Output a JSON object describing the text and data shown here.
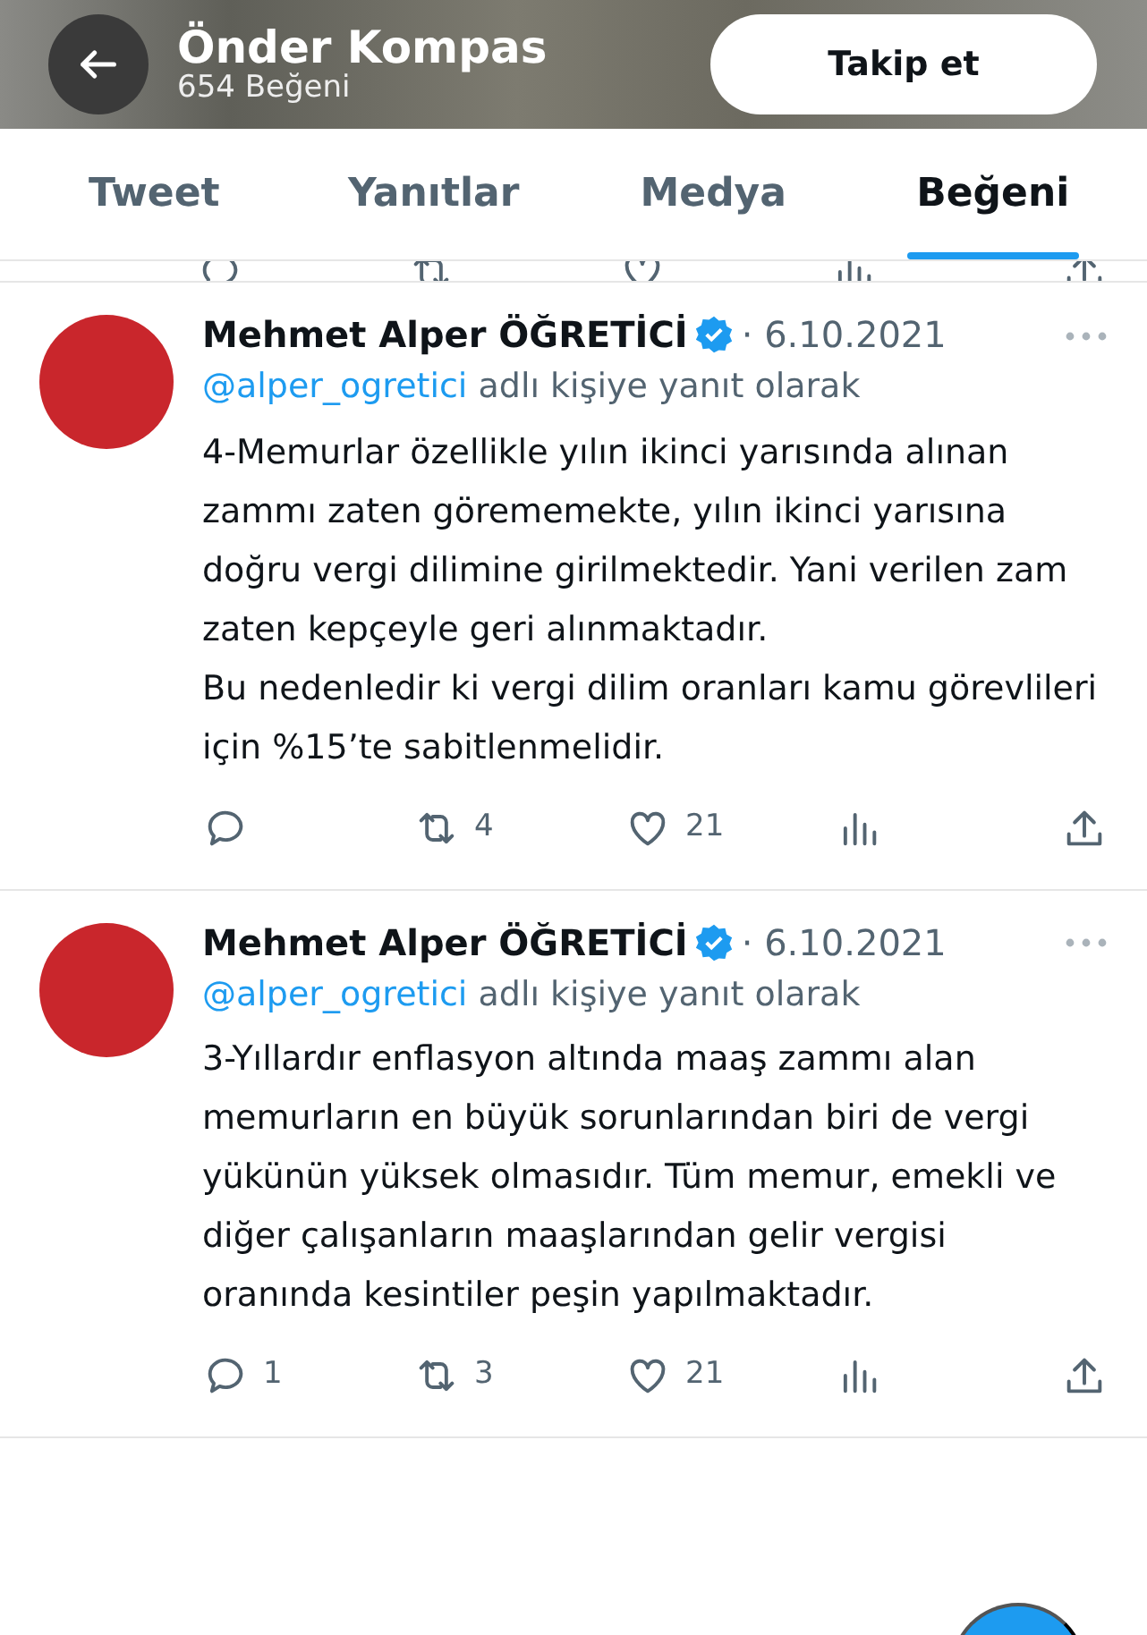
{
  "header": {
    "title": "Önder Kompas",
    "subtitle": "654 Beğeni",
    "follow_button": "Takip et"
  },
  "tabs": [
    {
      "label": "Tweet",
      "selected": false
    },
    {
      "label": "Yanıtlar",
      "selected": false
    },
    {
      "label": "Medya",
      "selected": false
    },
    {
      "label": "Beğeni",
      "selected": true
    }
  ],
  "tweets": [
    {
      "author": "Mehmet Alper ÖĞRETİCİ",
      "verified": true,
      "date": "· 6.10.2021",
      "reply_to_handle": "@alper_ogretici",
      "reply_to_text": "adlı kişiye yanıt olarak",
      "text": "4-Memurlar özellikle yılın ikinci yarısında alınan zammı zaten görememekte, yılın ikinci yarısına doğru vergi dilimine girilmektedir. Yani verilen zam zaten kepçeyle geri alınmaktadır.\nBu nedenledir ki vergi dilim oranları kamu görevlileri için %15’te sabitlenmelidir.",
      "retweets": "4",
      "likes": "21"
    },
    {
      "author": "Mehmet Alper ÖĞRETİCİ",
      "verified": true,
      "date": "· 6.10.2021",
      "reply_to_handle": "@alper_ogretici",
      "reply_to_text": "adlı kişiye yanıt olarak",
      "text": "3-Yıllardır enflasyon altında maaş zammı alan memurların en büyük sorunlarından biri de vergi yükünün yüksek olmasıdır. Tüm memur, emekli ve diğer çalışanların maaşlarından gelir vergisi oranında kesintiler peşin yapılmaktadır.",
      "replies": "1",
      "retweets": "3",
      "likes": "21"
    }
  ]
}
